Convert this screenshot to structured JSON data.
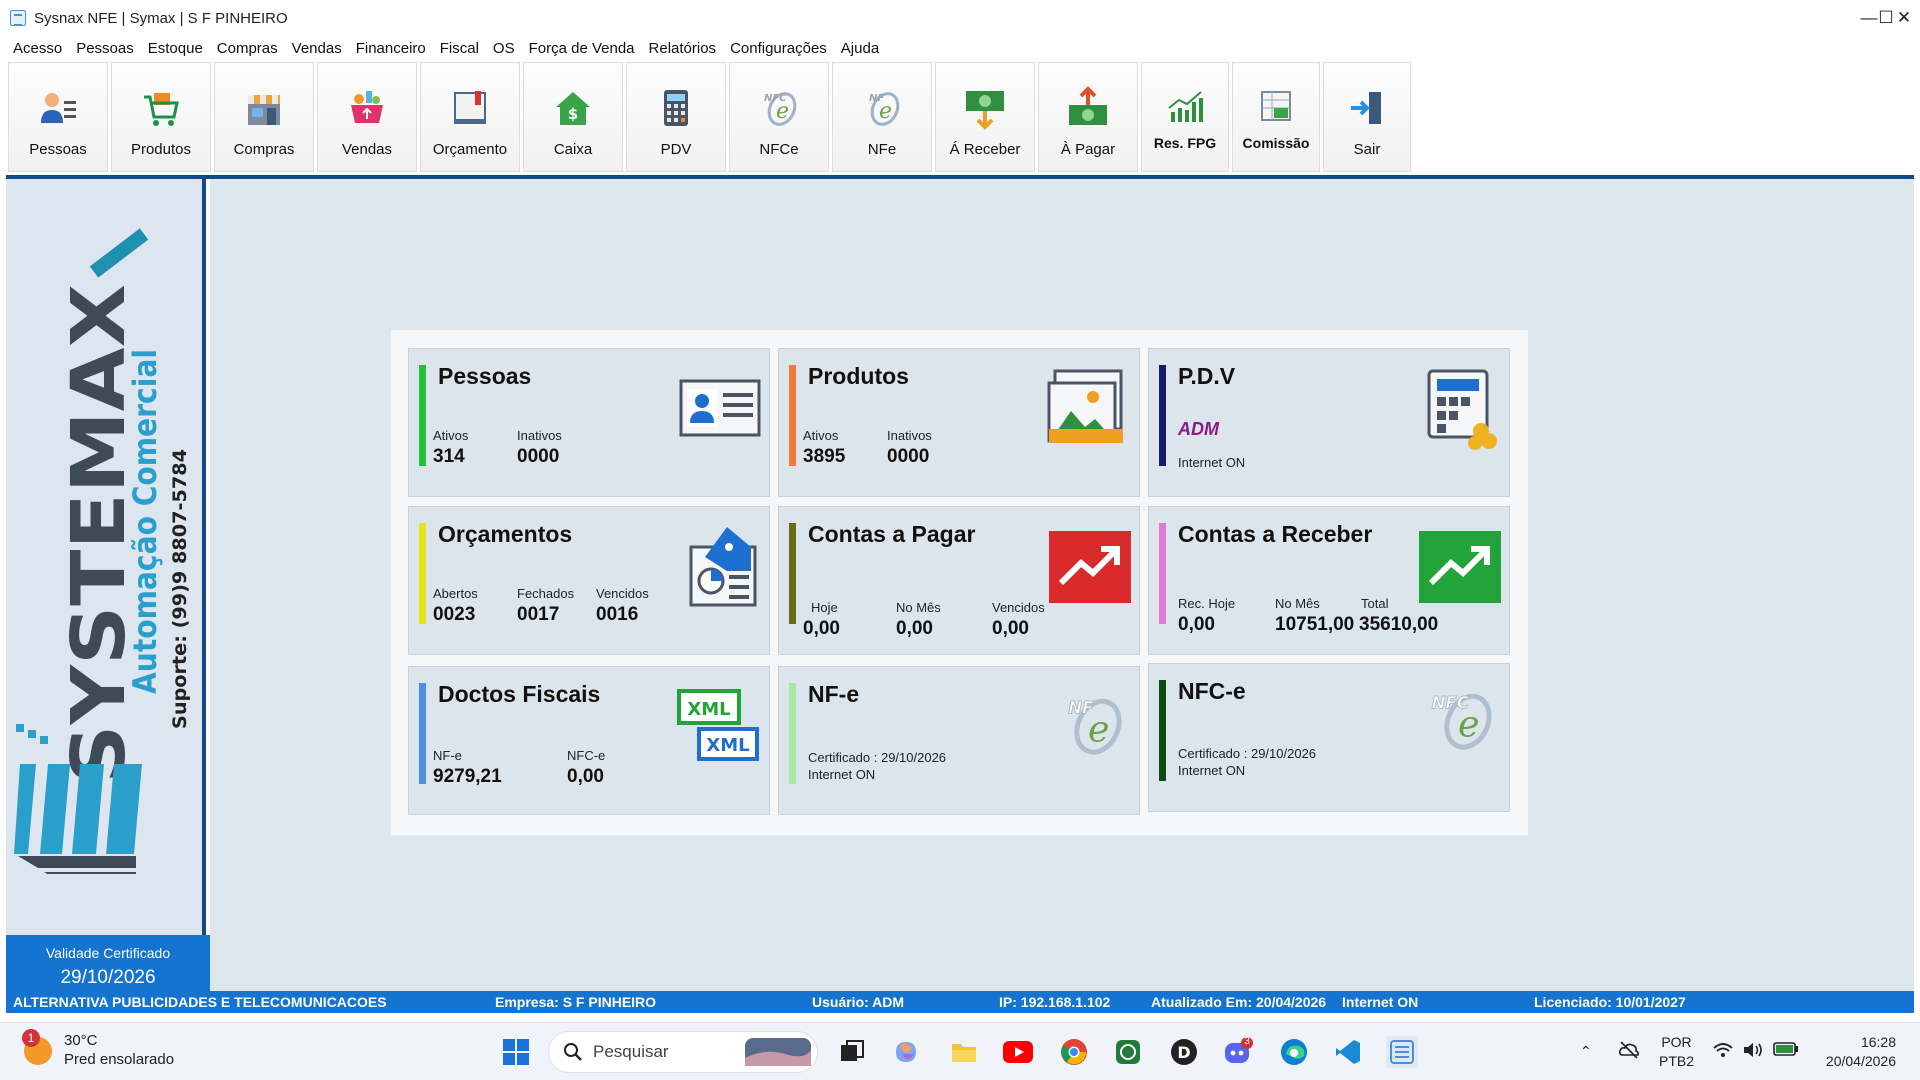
{
  "window": {
    "title": "Sysnax NFE | Symax | S F PINHEIRO"
  },
  "menu": [
    "Acesso",
    "Pessoas",
    "Estoque",
    "Compras",
    "Vendas",
    "Financeiro",
    "Fiscal",
    "OS",
    "Força de Venda",
    "Relatórios",
    "Configurações",
    "Ajuda"
  ],
  "toolbar": {
    "pessoas": "Pessoas",
    "produtos": "Produtos",
    "compras": "Compras",
    "vendas": "Vendas",
    "orcamento": "Orçamento",
    "caixa": "Caixa",
    "pdv": "PDV",
    "nfce": "NFCe",
    "nfe": "NFe",
    "a_receber": "Á Receber",
    "a_pagar": "À Pagar",
    "res_fpg": "Res. FPG",
    "comissao": "Comissão",
    "sair": "Sair"
  },
  "logo": {
    "brand": "SYSTEMAX",
    "tagline": "Automação Comercial",
    "support": "Suporte: (99)9 8807-5784"
  },
  "certificate": {
    "label": "Validade Certificado",
    "date": "29/10/2026"
  },
  "cards": {
    "pessoas": {
      "title": "Pessoas",
      "l1": "Ativos",
      "v1": "314",
      "l2": "Inativos",
      "v2": "0000"
    },
    "produtos": {
      "title": "Produtos",
      "l1": "Ativos",
      "v1": "3895",
      "l2": "Inativos",
      "v2": "0000"
    },
    "pdv": {
      "title": "P.D.V",
      "user": "ADM",
      "status": "Internet ON"
    },
    "orcamentos": {
      "title": "Orçamentos",
      "l1": "Abertos",
      "v1": "0023",
      "l2": "Fechados",
      "v2": "0017",
      "l3": "Vencidos",
      "v3": "0016"
    },
    "pagar": {
      "title": "Contas a Pagar",
      "l1": "Hoje",
      "v1": "0,00",
      "l2": "No Mês",
      "v2": "0,00",
      "l3": "Vencidos",
      "v3": "0,00"
    },
    "receber": {
      "title": "Contas a Receber",
      "l1": "Rec. Hoje",
      "v1": "0,00",
      "l2": "No Mês",
      "v2": "10751,00",
      "l3": "Total",
      "v3": "35610,00"
    },
    "fiscais": {
      "title": "Doctos Fiscais",
      "l1": "NF-e",
      "v1": "9279,21",
      "l2": "NFC-e",
      "v2": "0,00"
    },
    "nfe": {
      "title": "NF-e",
      "cert": "Certificado : 29/10/2026",
      "status": "Internet ON"
    },
    "nfce": {
      "title": "NFC-e",
      "cert": "Certificado : 29/10/2026",
      "status": "Internet ON"
    }
  },
  "statusbar": {
    "company_long": "ALTERNATIVA PUBLICIDADES E TELECOMUNICACOES",
    "empresa": "Empresa: S F PINHEIRO",
    "usuario": "Usuário: ADM",
    "ip": "IP: 192.168.1.102",
    "atualizado": "Atualizado Em: 20/04/2026",
    "internet": "Internet ON",
    "licenciado": "Licenciado: 10/01/2027"
  },
  "taskbar": {
    "weather_badge": "1",
    "temp": "30°C",
    "weather_desc": "Pred ensolarado",
    "search_placeholder": "Pesquisar",
    "discord_badge": "3",
    "lang1": "POR",
    "lang2": "PTB2",
    "time": "16:28",
    "date": "20/04/2026"
  },
  "colors": {
    "accent_blue": "#1574cf",
    "dark_blue": "#114a8a",
    "bar_pessoas": "#22c232",
    "bar_produtos": "#ef7a3a",
    "bar_pdv": "#141a6e",
    "bar_orcamentos": "#e8e41a",
    "bar_pagar": "#6b6a14",
    "bar_receber": "#e07ad8",
    "bar_fiscais": "#4f8fe0",
    "bar_nfe": "#a6e8a4",
    "bar_nfce": "#0e4a14"
  }
}
